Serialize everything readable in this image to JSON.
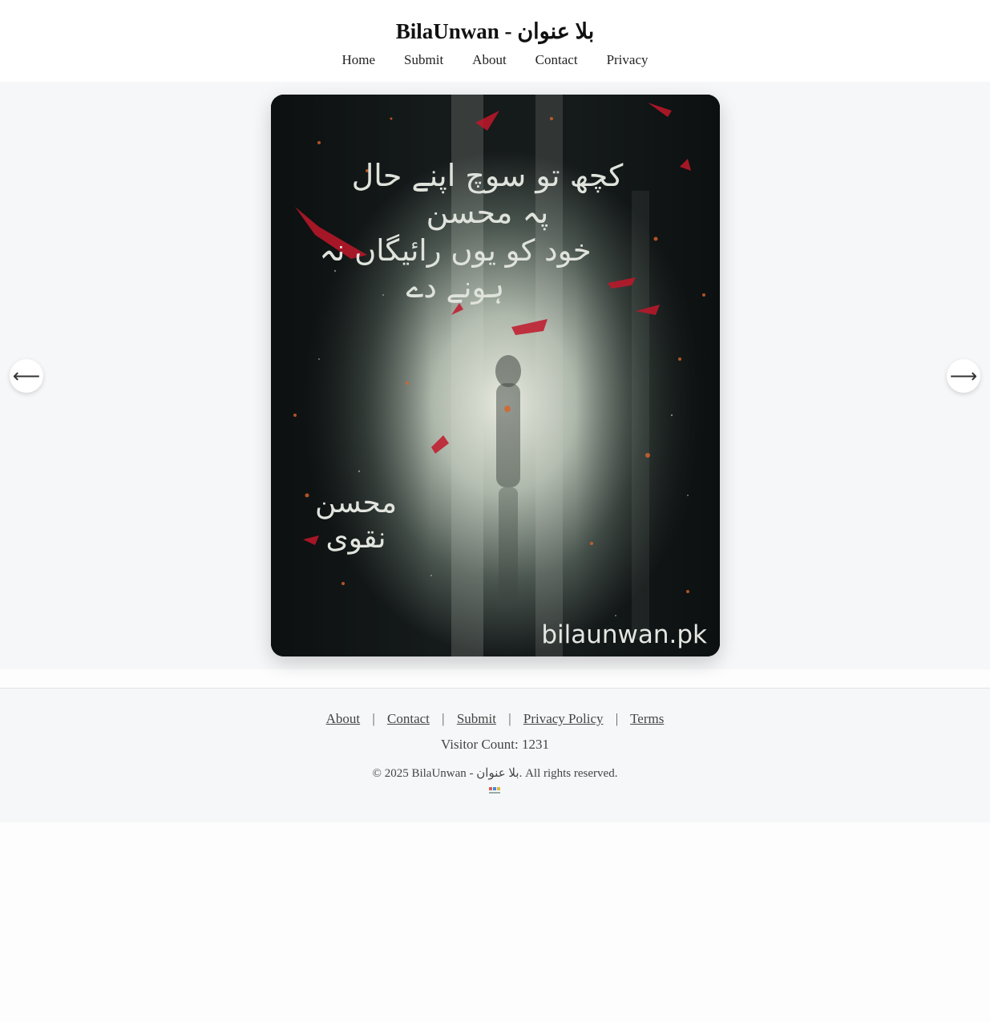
{
  "header": {
    "title": "BilaUnwan - بلا عنوان",
    "nav": [
      "Home",
      "Submit",
      "About",
      "Contact",
      "Privacy"
    ]
  },
  "slider": {
    "prev_icon": "arrow-left-icon",
    "next_icon": "arrow-right-icon",
    "prev_label": "⟵",
    "next_label": "⟶",
    "slide": {
      "poem_line_1": "کچھ تو سوچ اپنے حال پہ محسن",
      "poem_line_2": "خود کو یوں رائیگاں نہ ہونے دے",
      "poet": "محسن نقوی",
      "watermark": "bilaunwan.pk"
    }
  },
  "footer": {
    "links": [
      "About",
      "Contact",
      "Submit",
      "Privacy Policy",
      "Terms"
    ],
    "separator": "|",
    "visitor_count": "Visitor Count: 1231",
    "copyright": "© 2025 BilaUnwan - بلا عنوان. All rights reserved."
  },
  "colors": {
    "page_bg": "#f6f7f8",
    "header_bg": "#ffffff",
    "accent_red": "#c0182a"
  }
}
